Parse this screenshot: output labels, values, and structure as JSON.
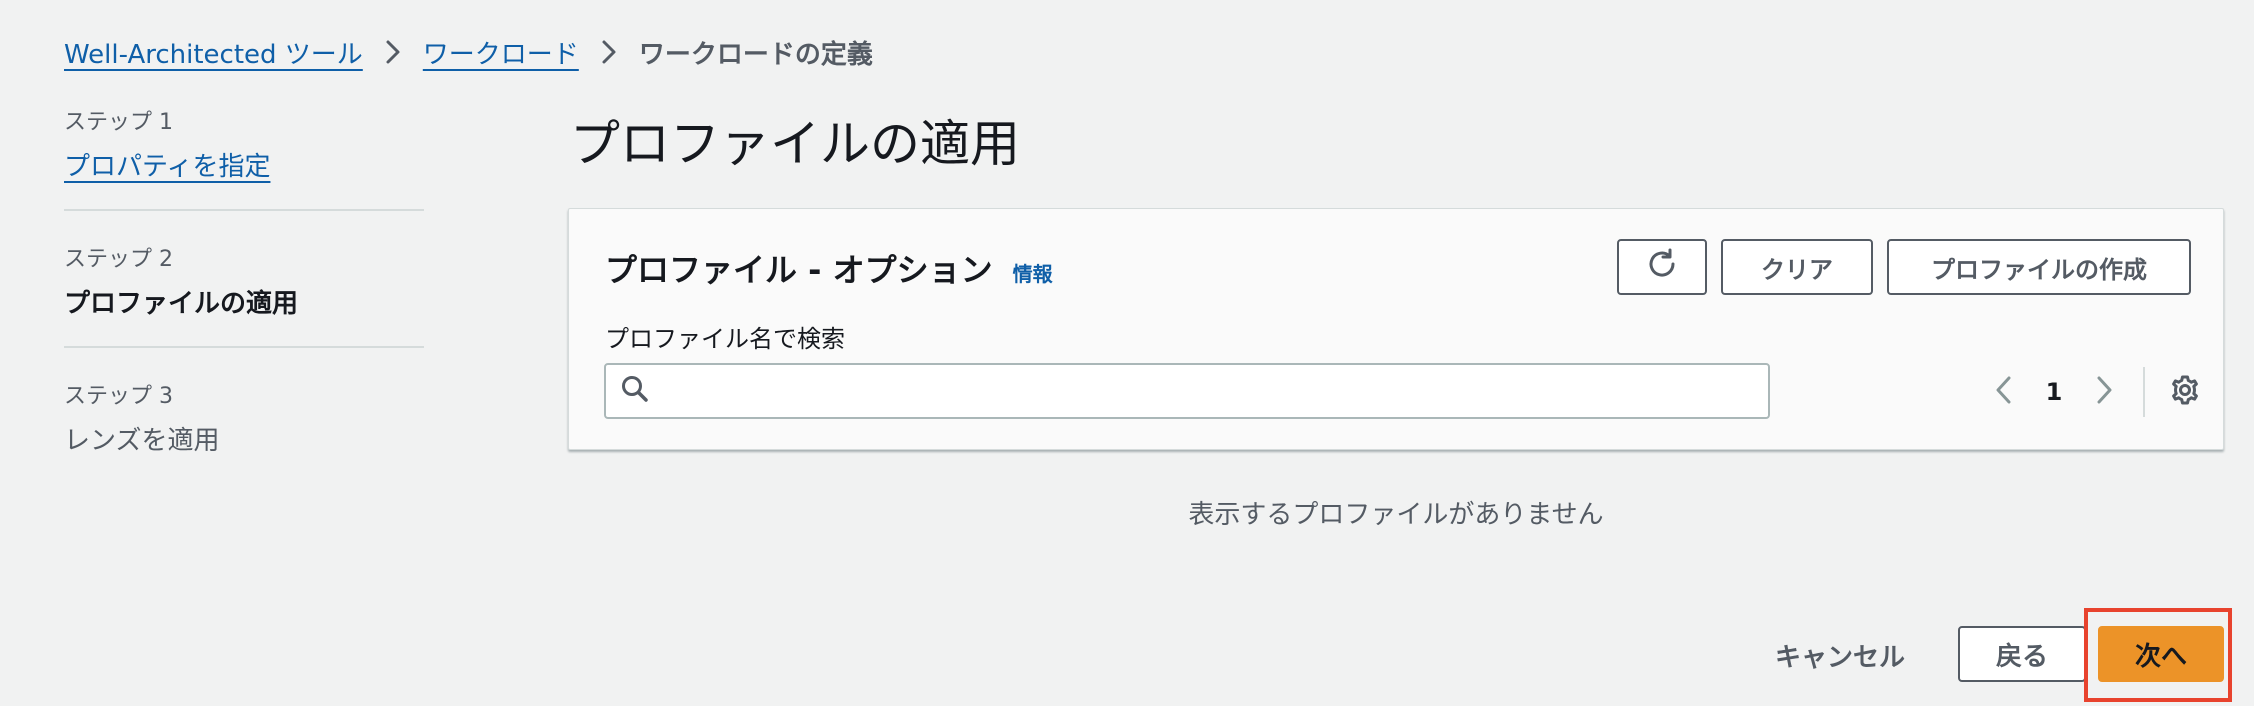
{
  "breadcrumb": {
    "items": [
      {
        "label": "Well-Architected ツール"
      },
      {
        "label": "ワークロード"
      }
    ],
    "current": "ワークロードの定義"
  },
  "steps": [
    {
      "number": "ステップ 1",
      "title": "プロパティを指定",
      "state": "link"
    },
    {
      "number": "ステップ 2",
      "title": "プロファイルの適用",
      "state": "active"
    },
    {
      "number": "ステップ 3",
      "title": "レンズを適用",
      "state": "disabled"
    }
  ],
  "main": {
    "title": "プロファイルの適用"
  },
  "panel": {
    "title": "プロファイル - オプション",
    "info_label": "情報",
    "clear_label": "クリア",
    "create_label": "プロファイルの作成",
    "search_label": "プロファイル名で検索",
    "search_value": "",
    "search_placeholder": "",
    "current_page": "1"
  },
  "empty_message": "表示するプロファイルがありません",
  "footer": {
    "cancel_label": "キャンセル",
    "back_label": "戻る",
    "next_label": "次へ"
  },
  "icons": {
    "breadcrumb_separator": "chevron-right-icon",
    "refresh": "refresh-icon",
    "search": "search-icon",
    "prev": "chevron-left-icon",
    "next": "chevron-right-icon",
    "settings": "gear-icon"
  },
  "colors": {
    "link": "#0f5fa8",
    "primary_button": "#ec9328",
    "highlight": "#e8432e",
    "background": "#f1f2f2"
  }
}
